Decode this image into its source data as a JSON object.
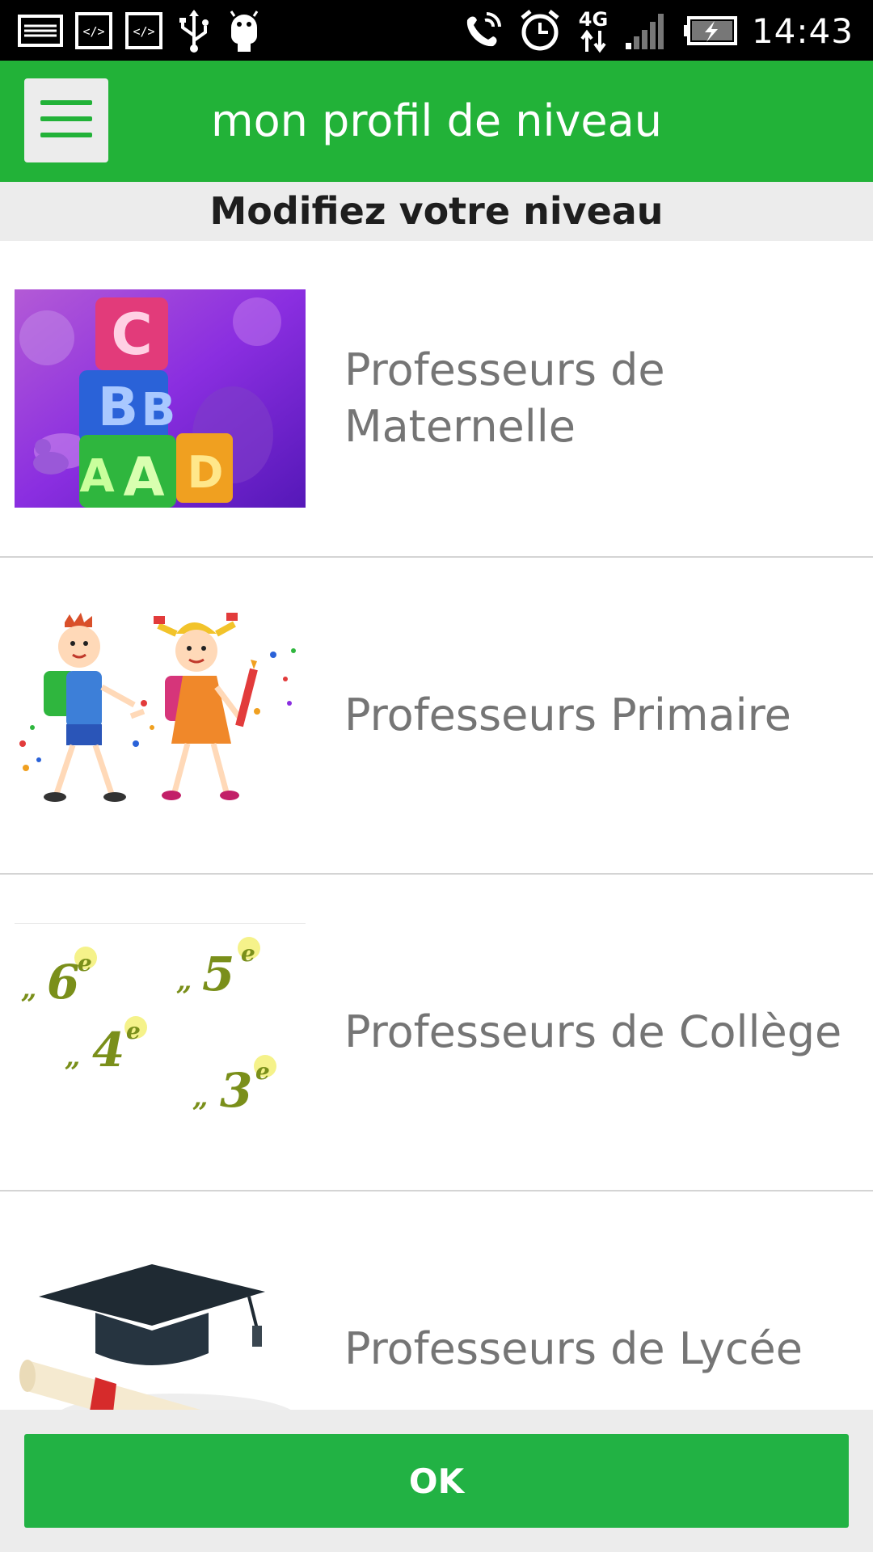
{
  "status_bar": {
    "time": "14:43",
    "network_label": "4G",
    "left_icons": [
      "image-notification-icon",
      "code-notification-icon",
      "code-notification-icon",
      "usb-icon",
      "android-icon"
    ],
    "right_icons": [
      "call-forward-icon",
      "alarm-clock-icon",
      "network-4g-icon",
      "signal-strength-icon",
      "battery-charging-icon"
    ]
  },
  "appbar": {
    "title": "mon profil de niveau",
    "menu_icon": "hamburger-menu-icon",
    "color": "#22b238"
  },
  "subheader": {
    "title": "Modifiez votre niveau"
  },
  "levels": [
    {
      "label": "Professeurs de Maternelle",
      "image": "alphabet-blocks-image"
    },
    {
      "label": "Professeurs Primaire",
      "image": "schoolchildren-image"
    },
    {
      "label": "Professeurs de Collège",
      "image": "grade-numbers-image",
      "grades": [
        "6",
        "5",
        "4",
        "3"
      ],
      "grade_suffix": "e"
    },
    {
      "label": "Professeurs de Lycée",
      "image": "graduation-cap-diploma-image"
    }
  ],
  "footer": {
    "ok_label": "OK",
    "button_color": "#22b244"
  }
}
